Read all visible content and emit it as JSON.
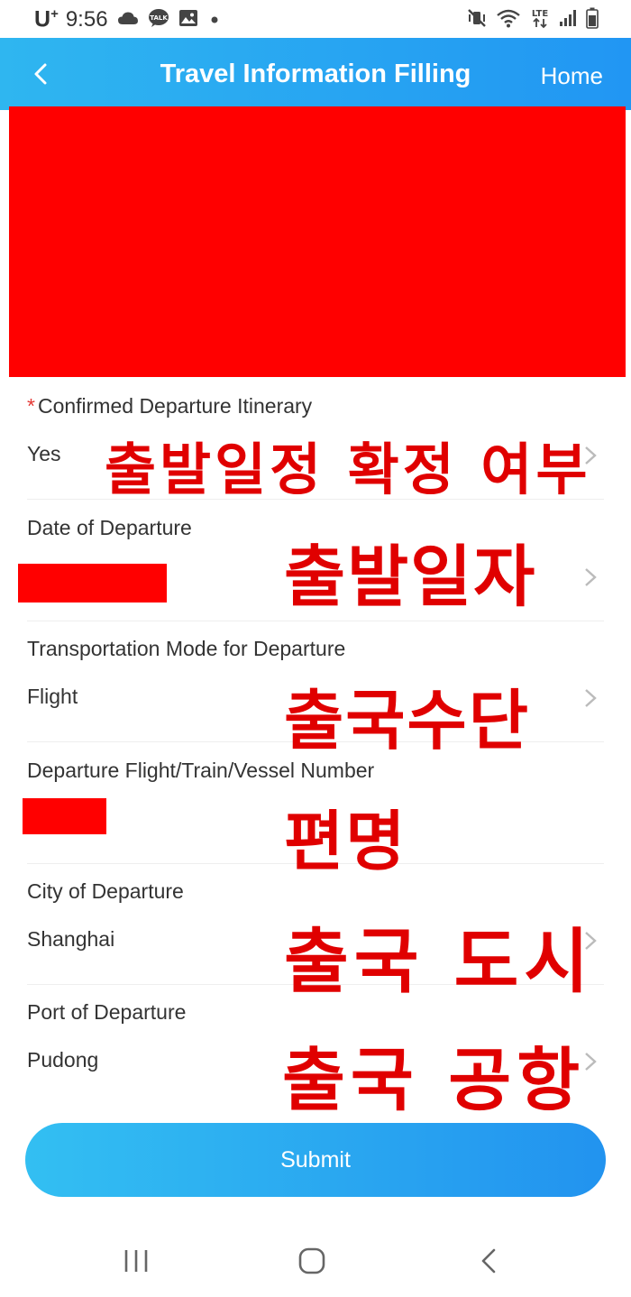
{
  "status_bar": {
    "carrier": "U",
    "carrier_sup": "+",
    "time": "9:56",
    "left_icons": [
      "cloud-icon",
      "talk-icon",
      "gallery-icon",
      "dot-icon"
    ],
    "right_icons": [
      "mute-vibrate-icon",
      "wifi-icon",
      "lte-icon",
      "signal-icon",
      "battery-icon"
    ],
    "talk_text": "TALK",
    "lte_text": "LTE"
  },
  "header": {
    "back_icon": "chevron-left-icon",
    "title": "Travel Information Filling",
    "home_label": "Home"
  },
  "form": {
    "fields": [
      {
        "label": "Confirmed Departure Itinerary",
        "required": "*",
        "value": "Yes",
        "annotation": "출발일정 확정 여부"
      },
      {
        "label": "Date of Departure",
        "value": "",
        "annotation": "출발일자"
      },
      {
        "label": "Transportation Mode for Departure",
        "value": "Flight",
        "annotation": "출국수단"
      },
      {
        "label": "Departure Flight/Train/Vessel Number",
        "value": "",
        "annotation": "편명"
      },
      {
        "label": "City of Departure",
        "value": "Shanghai",
        "annotation": "출국 도시"
      },
      {
        "label": "Port of Departure",
        "value": "Pudong",
        "annotation": "출국 공항"
      }
    ]
  },
  "submit": {
    "label": "Submit"
  },
  "nav_bar": {
    "icons": [
      "recent-apps-icon",
      "home-icon",
      "back-icon"
    ]
  },
  "colors": {
    "header_start": "#2fb6f0",
    "header_end": "#2196f3",
    "redaction": "#ff0000",
    "annotation": "#e00000",
    "required": "#e53935"
  }
}
